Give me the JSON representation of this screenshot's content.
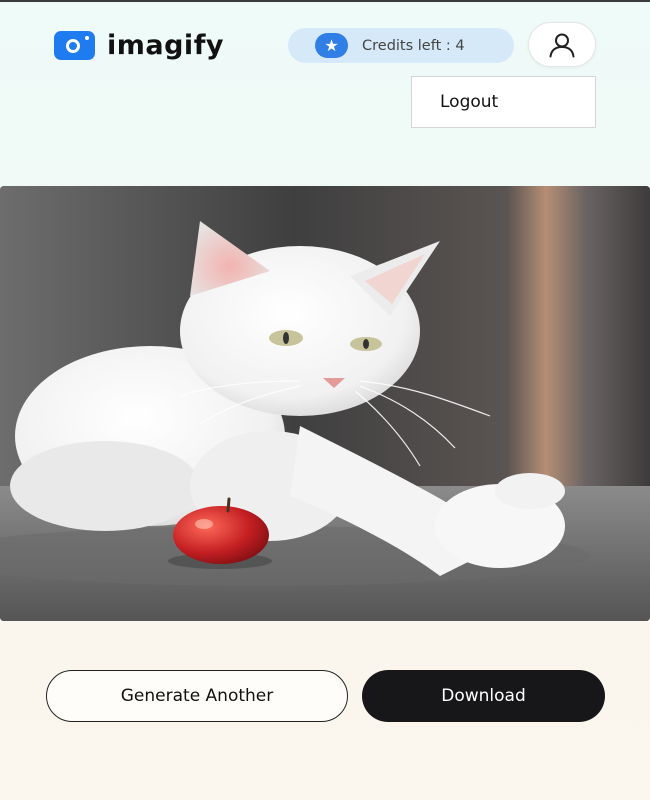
{
  "brand": {
    "name": "imagify",
    "logo_icon": "camera-lens-icon",
    "accent": "#1f7cf0"
  },
  "credits": {
    "label": "Credits left : 4",
    "icon": "star-icon"
  },
  "user": {
    "icon": "user-icon"
  },
  "menu": {
    "items": [
      "Logout"
    ]
  },
  "image": {
    "alt": "white cat reaching toward a red apple"
  },
  "actions": {
    "generate_another": "Generate Another",
    "download": "Download"
  },
  "colors": {
    "primary_button": "#17171a",
    "credits_pill": "#d6e9f8",
    "star_badge": "#2f7fe6"
  }
}
